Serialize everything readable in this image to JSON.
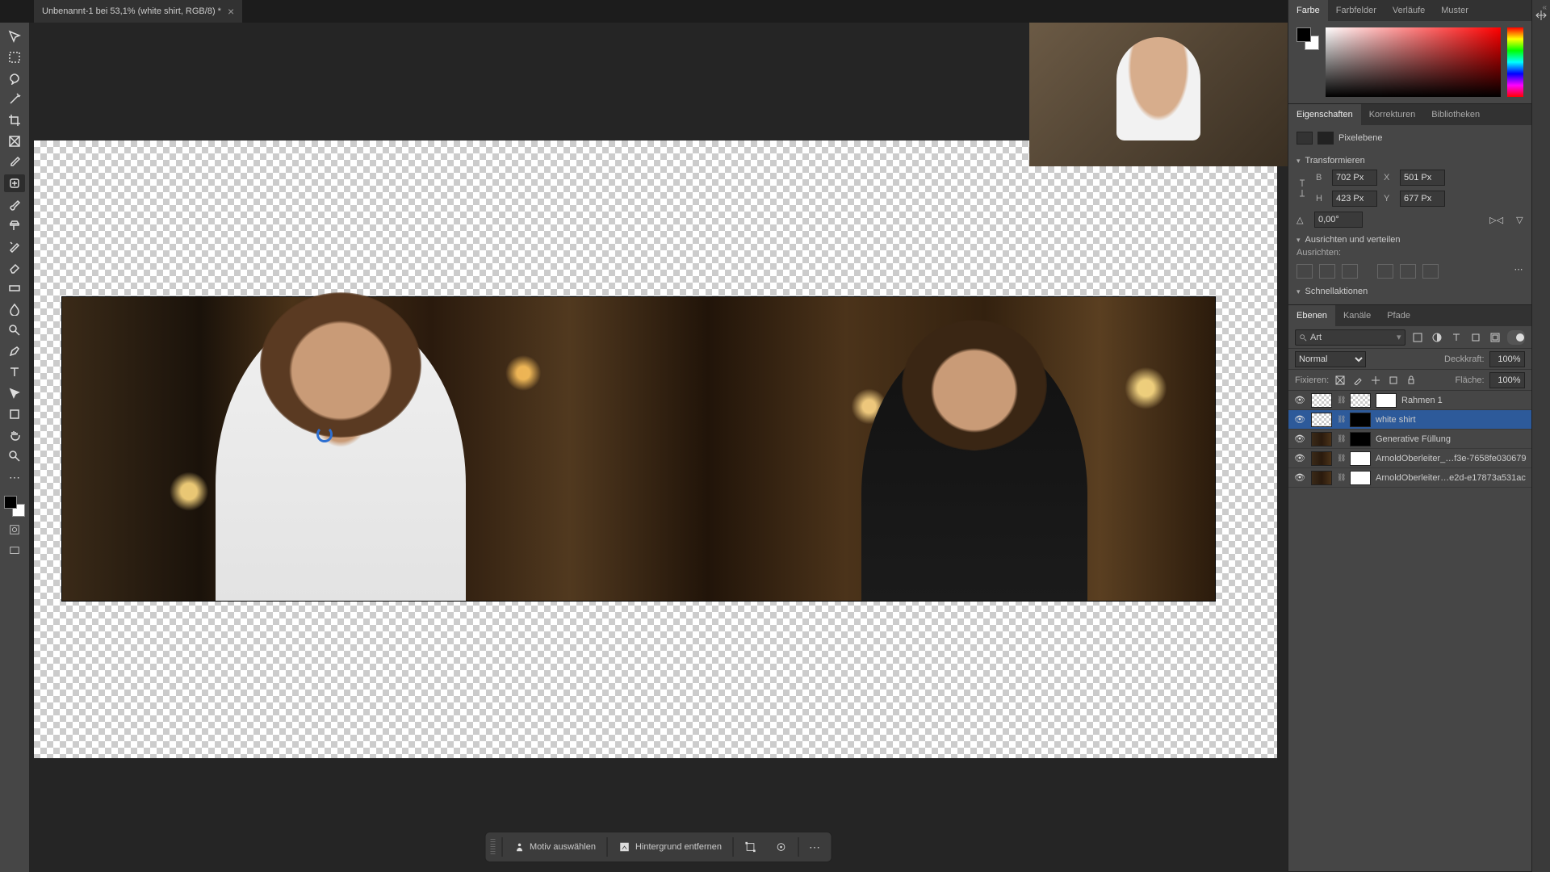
{
  "tab": {
    "title": "Unbenannt-1 bei 53,1% (white shirt, RGB/8) *"
  },
  "color_panel": {
    "tabs": [
      "Farbe",
      "Farbfelder",
      "Verläufe",
      "Muster"
    ],
    "active": "Farbe"
  },
  "props_panel": {
    "tabs": [
      "Eigenschaften",
      "Korrekturen",
      "Bibliotheken"
    ],
    "active": "Eigenschaften",
    "type_label": "Pixelebene",
    "transform": {
      "title": "Transformieren",
      "w_label": "B",
      "w": "702 Px",
      "h_label": "H",
      "h": "423 Px",
      "x_label": "X",
      "x": "501 Px",
      "y_label": "Y",
      "y": "677 Px",
      "angle": "0,00°"
    },
    "align": {
      "title": "Ausrichten und verteilen",
      "sub": "Ausrichten:"
    },
    "quick": {
      "title": "Schnellaktionen"
    }
  },
  "layers_panel": {
    "tabs": [
      "Ebenen",
      "Kanäle",
      "Pfade"
    ],
    "active": "Ebenen",
    "search_kind": "Art",
    "blend_label": "",
    "blend_mode": "Normal",
    "opacity_label": "Deckkraft:",
    "opacity": "100%",
    "lock_label": "Fixieren:",
    "fill_label": "Fläche:",
    "fill": "100%",
    "layers": [
      {
        "name": "Rahmen 1",
        "selected": false,
        "thumbs": [
          "chk",
          "chk",
          "mask"
        ],
        "visible": true
      },
      {
        "name": "white shirt",
        "selected": true,
        "thumbs": [
          "chk",
          "mask-b"
        ],
        "visible": true
      },
      {
        "name": "Generative Füllung",
        "selected": false,
        "thumbs": [
          "photo-t",
          "mask-b"
        ],
        "visible": true
      },
      {
        "name": "ArnoldOberleiter_…f3e-7658fe030679",
        "selected": false,
        "thumbs": [
          "photo-t",
          "mask"
        ],
        "visible": true
      },
      {
        "name": "ArnoldOberleiter…e2d-e17873a531ac",
        "selected": false,
        "thumbs": [
          "photo-t",
          "mask"
        ],
        "visible": true
      }
    ]
  },
  "ctxbar": {
    "select_subject": "Motiv auswählen",
    "remove_bg": "Hintergrund entfernen"
  },
  "tooltips": {
    "move": "move",
    "marquee": "marquee",
    "lasso": "lasso",
    "wand": "wand",
    "crop": "crop",
    "frame": "frame",
    "eyedrop": "eyedrop",
    "heal": "heal",
    "brush": "brush",
    "stamp": "stamp",
    "history": "history",
    "eraser": "eraser",
    "gradient": "gradient",
    "blur": "blur",
    "dodge": "dodge",
    "pen": "pen",
    "type": "type",
    "path": "path",
    "shape": "shape",
    "hand": "hand",
    "zoom": "zoom"
  }
}
